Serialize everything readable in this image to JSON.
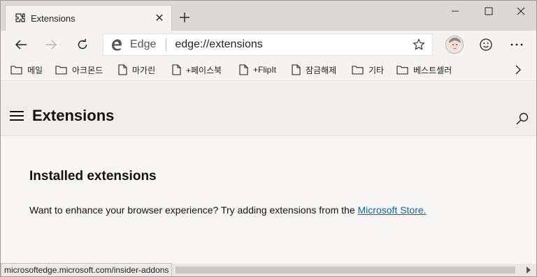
{
  "tab": {
    "title": "Extensions",
    "close": "✕"
  },
  "window_controls": {
    "minimize": "minimize",
    "maximize": "maximize",
    "close": "close"
  },
  "toolbar": {
    "edge_label": "Edge",
    "url": "edge://extensions"
  },
  "favorites": [
    {
      "label": "메일",
      "icon": "folder-icon"
    },
    {
      "label": "아크몬드",
      "icon": "folder-icon"
    },
    {
      "label": "마가린",
      "icon": "page-icon"
    },
    {
      "label": "+페이스북",
      "icon": "page-icon"
    },
    {
      "label": "+FlipIt",
      "icon": "page-icon"
    },
    {
      "label": "잠금해제",
      "icon": "page-icon"
    },
    {
      "label": "기타",
      "icon": "folder-icon"
    },
    {
      "label": "베스트셀러",
      "icon": "folder-icon"
    }
  ],
  "page": {
    "title": "Extensions",
    "section_title": "Installed extensions",
    "promo_text": "Want to enhance your browser experience? Try adding extensions from the ",
    "store_link": "Microsoft Store."
  },
  "status_bar": {
    "text": "microsoftedge.microsoft.com/insider-addons"
  },
  "colors": {
    "accent_link": "#0067b8",
    "tabbar": "#dad9d8",
    "toolbar": "#f4f3f2"
  }
}
